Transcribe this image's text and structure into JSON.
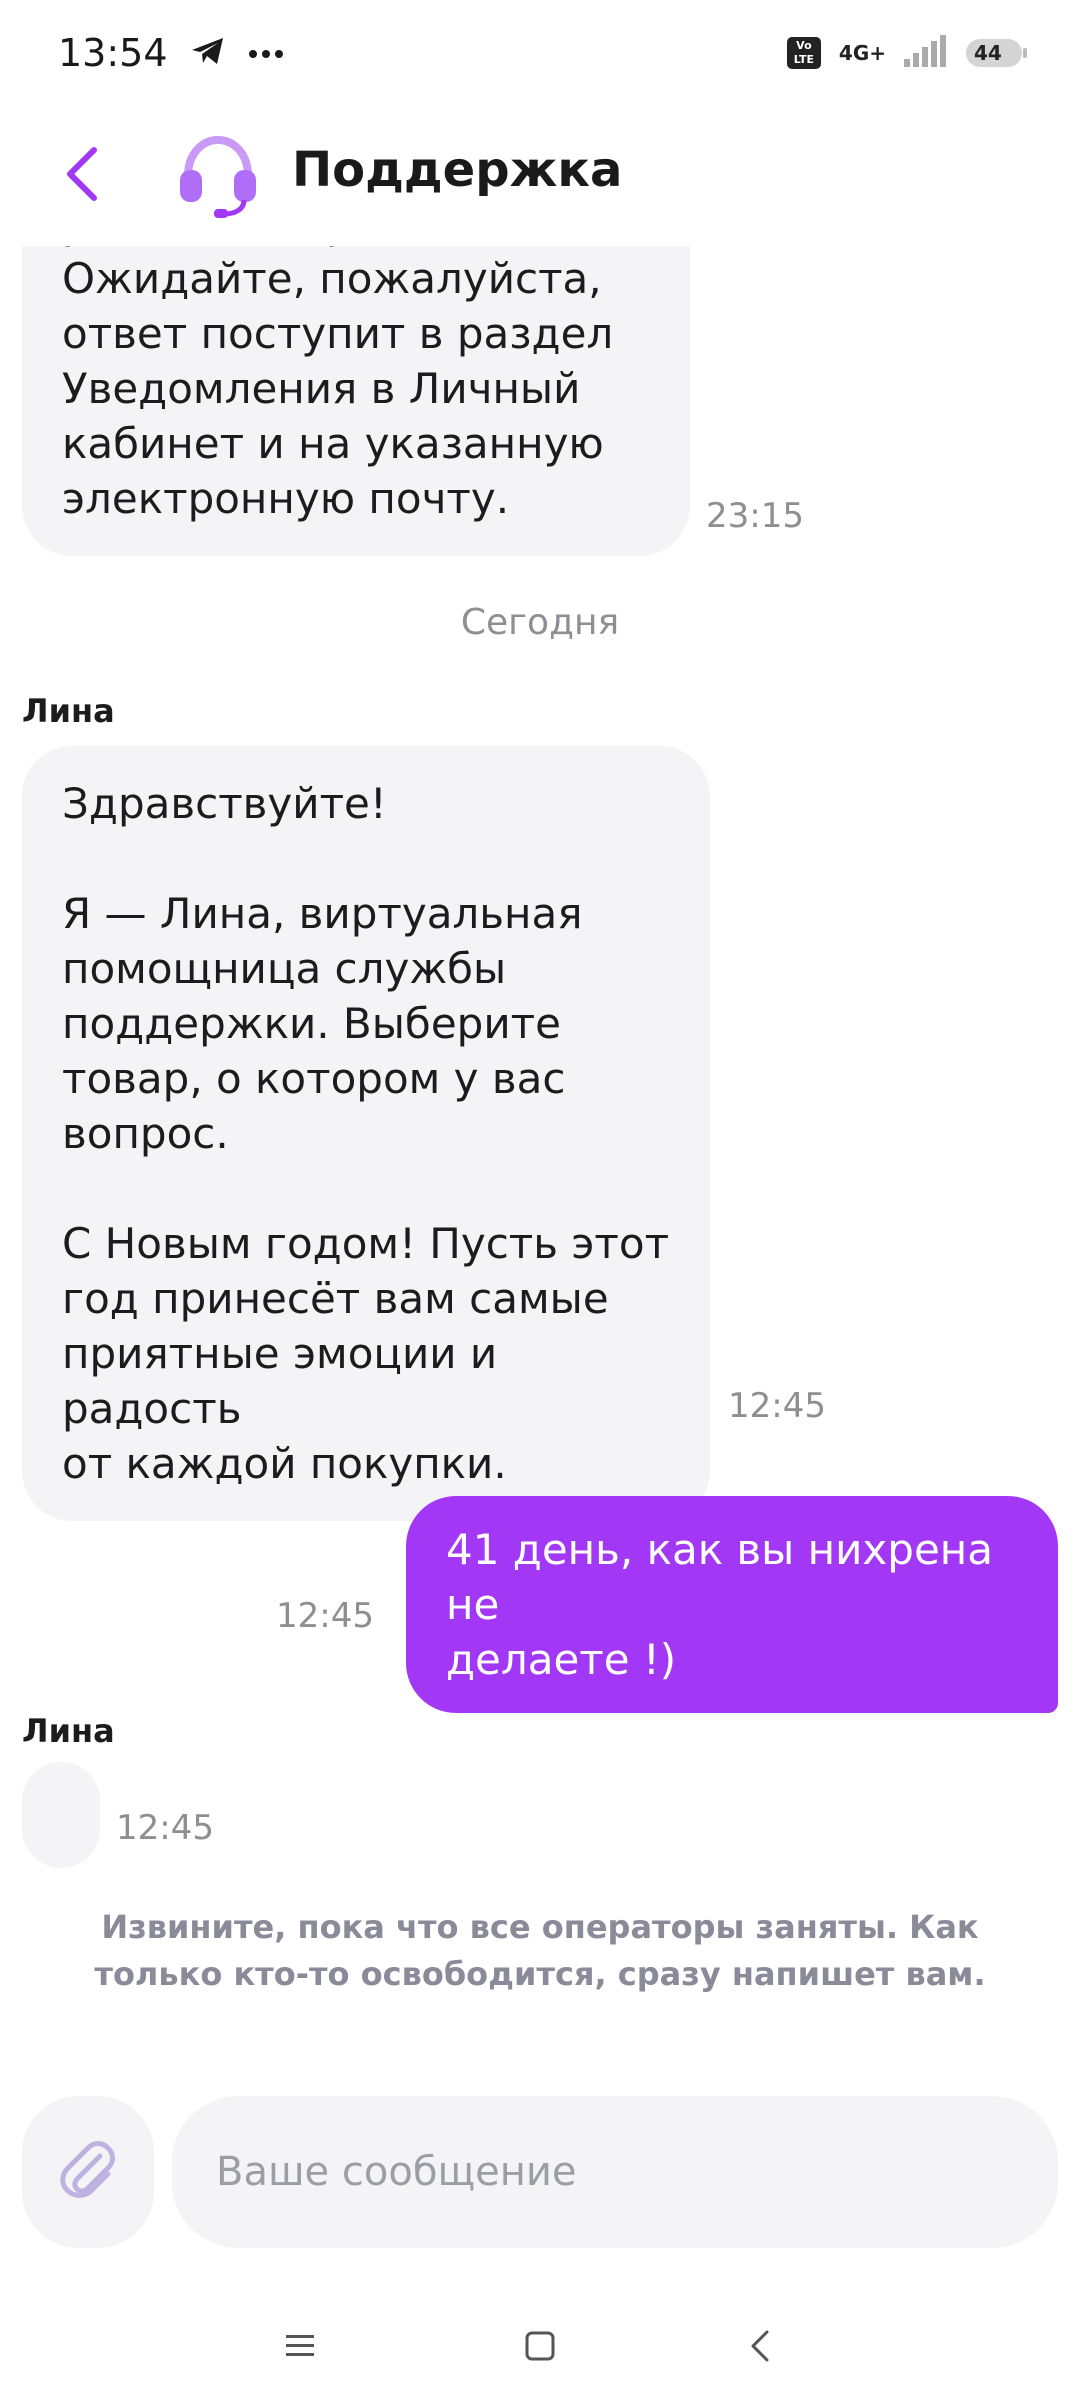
{
  "status_bar": {
    "time": "13:54",
    "volte": "Vo LTE",
    "network": "4G+",
    "battery": "44"
  },
  "header": {
    "title": "Поддержка",
    "accent_color": "#a238f5"
  },
  "messages": {
    "first": {
      "text": "регламентированы.\nОжидайте, пожалуйста,\nответ поступит в раздел\nУведомления в Личный\nкабинет и на указанную\nэлектронную почту.",
      "time": "23:15"
    },
    "date_separator": "Сегодня",
    "greeting": {
      "sender": "Лина",
      "text": "Здравствуйте!\n\nЯ — Лина, виртуальная\nпомощница службы\nподдержки. Выберите\nтовар, о котором у вас\nвопрос.\n\nС Новым годом! Пусть этот\nгод принесёт вам самые\nприятные эмоции и радость\nот каждой покупки.",
      "time": "12:45"
    },
    "user_message": {
      "text": "41 день, как вы нихрена не\nделаете !)",
      "time": "12:45"
    },
    "typing": {
      "sender": "Лина",
      "time": "12:45"
    },
    "operators_notice": "Извините, пока что все операторы заняты. Как\nтолько кто-то освободится, сразу напишет вам."
  },
  "composer": {
    "placeholder": "Ваше сообщение",
    "attach_icon": "paperclip-icon"
  },
  "nav_bar": {
    "icons": [
      "menu-icon",
      "home-icon",
      "back-icon"
    ]
  }
}
